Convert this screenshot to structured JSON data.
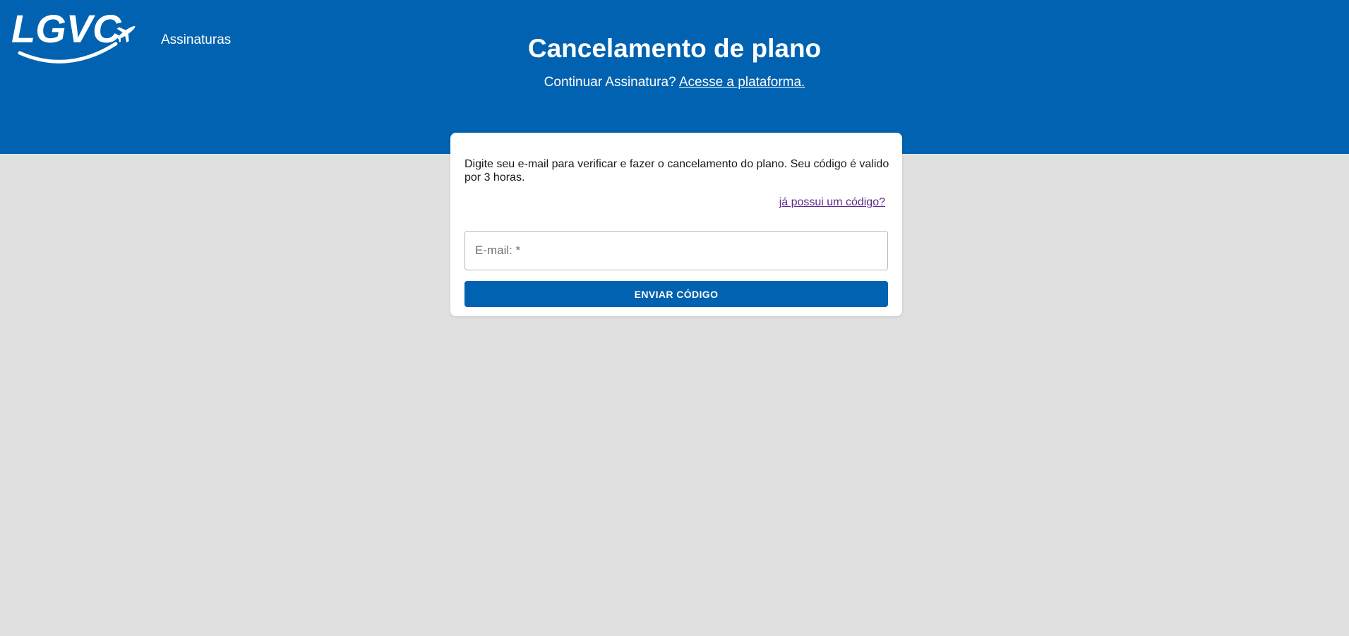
{
  "header": {
    "logo_text": "LGVC",
    "brand_subtitle": "Assinaturas",
    "title": "Cancelamento de plano",
    "subtitle_prefix": "Continuar Assinatura?",
    "subtitle_link": "Acesse a plataforma."
  },
  "card": {
    "description": "Digite seu e-mail para verificar e fazer o cancelamento do plano. Seu código é valido por 3 horas.",
    "code_link": "já possui um código?",
    "email_placeholder": "E-mail: *",
    "email_value": "",
    "send_button": "ENVIAR CÓDIGO"
  },
  "colors": {
    "brand_blue": "#0062b0",
    "page_background": "#e0e0e0",
    "visited_link": "#5b2a86"
  },
  "icons": {
    "logo_plane": "airplane-icon"
  }
}
